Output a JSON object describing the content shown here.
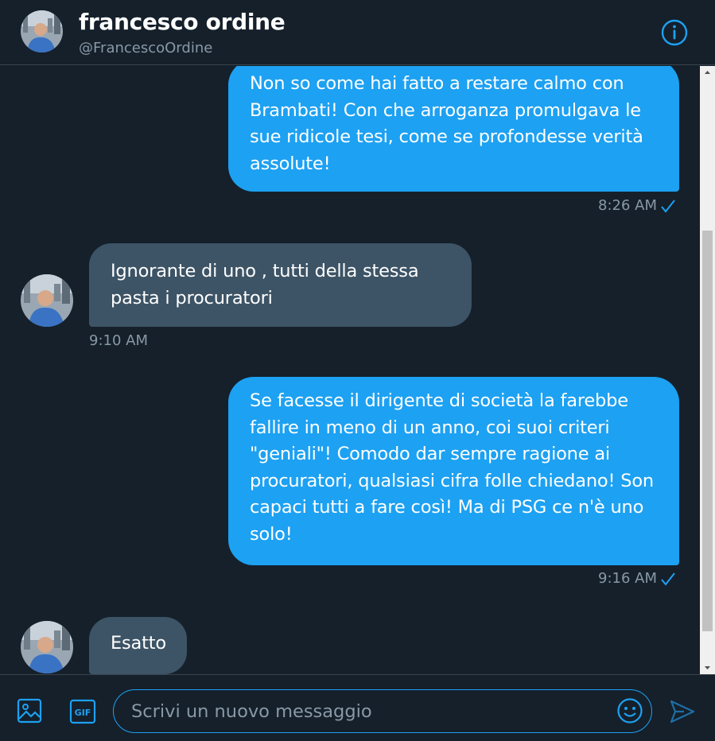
{
  "header": {
    "name": "francesco ordine",
    "handle": "@FrancescoOrdine",
    "info_icon": "info-icon"
  },
  "messages": [
    {
      "direction": "outgoing",
      "text": "Non so come hai fatto a restare calmo con Brambati! Con che arroganza promulgava le sue ridicole tesi, come se profondesse verità assolute!",
      "time": "8:26 AM",
      "status_icon": "checkmark-icon"
    },
    {
      "direction": "incoming",
      "text": "Ignorante di uno , tutti della stessa pasta i procuratori",
      "time": "9:10 AM"
    },
    {
      "direction": "outgoing",
      "text": "Se facesse il dirigente di società la farebbe fallire in meno di un anno, coi suoi criteri \"geniali\"! Comodo dar sempre ragione ai procuratori, qualsiasi cifra folle chiedano! Son capaci tutti a fare così! Ma di PSG ce n'è uno solo!",
      "time": "9:16 AM",
      "status_icon": "checkmark-icon"
    },
    {
      "direction": "incoming",
      "text": "Esatto"
    }
  ],
  "composer": {
    "placeholder": "Scrivi un nuovo messaggio",
    "value": "",
    "media_icon": "image-icon",
    "gif_label": "GIF",
    "emoji_icon": "emoji-icon",
    "send_icon": "send-icon"
  },
  "colors": {
    "background": "#15202b",
    "accent": "#1da1f2",
    "incoming_bubble": "#3d5466",
    "muted_text": "#8899a6"
  }
}
